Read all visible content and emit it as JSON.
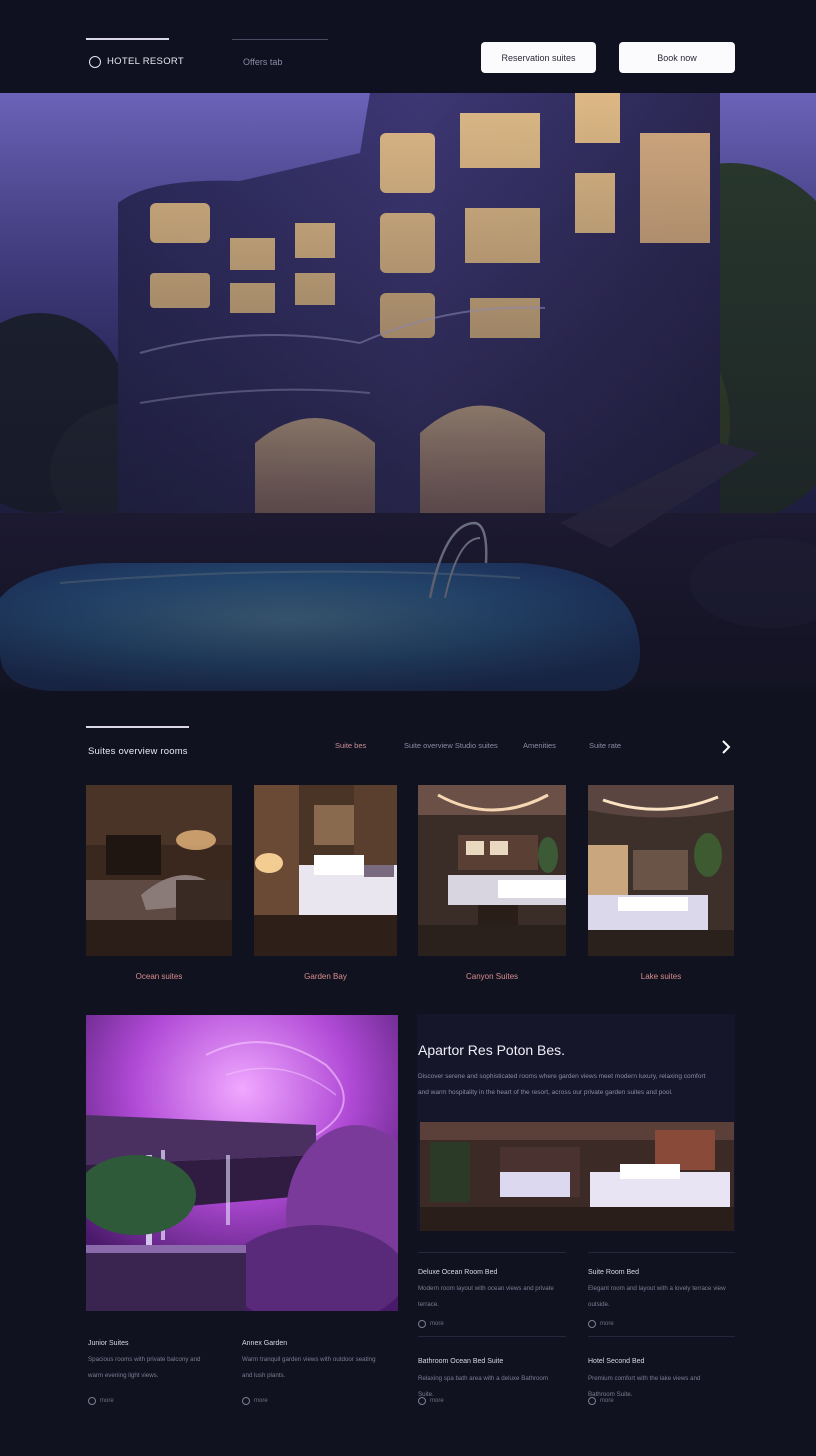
{
  "header": {
    "logo_text": "HOTEL RESORT",
    "nav_link": "Offers tab",
    "button_primary": "Reservation suites",
    "button_secondary": "Book now"
  },
  "suites": {
    "title": "Suites overview rooms",
    "filters": [
      {
        "label": "Suite bes",
        "active": true
      },
      {
        "label": "Suite overview Studio suites",
        "active": false
      },
      {
        "label": "Amenities",
        "active": false
      },
      {
        "label": "Suite rate",
        "active": false
      }
    ],
    "cards": [
      {
        "label": "Ocean suites"
      },
      {
        "label": "Garden Bay"
      },
      {
        "label": "Canyon Suites"
      },
      {
        "label": "Lake suites"
      }
    ]
  },
  "feature": {
    "title": "Apartor Res Poton Bes.",
    "description": "Discover serene and sophisticated rooms where garden views meet modern luxury, relaxing comfort and warm hospitality in the heart of the resort, across our private garden suites and pool."
  },
  "info_blocks": [
    {
      "title": "Junior Suites",
      "text": "Spacious rooms with private balcony and warm evening light views.",
      "meta": "more"
    },
    {
      "title": "Annex Garden",
      "text": "Warm tranquil garden views with outdoor seating and lush plants.",
      "meta": "more"
    },
    {
      "title": "Deluxe Ocean Room Bed",
      "text": "Modern room layout with ocean views and private terrace.",
      "meta": "more"
    },
    {
      "title": "Suite Room Bed",
      "text": "Elegant room and layout with a lovely terrace view outside.",
      "meta": "more"
    },
    {
      "title": "Bathroom Ocean Bed Suite",
      "text": "Relaxing spa bath area with a deluxe Bathroom Suite.",
      "meta": "more"
    },
    {
      "title": "Hotel Second Bed",
      "text": "Premium comfort with the lake views and Bathroom Suite.",
      "meta": "more"
    }
  ]
}
